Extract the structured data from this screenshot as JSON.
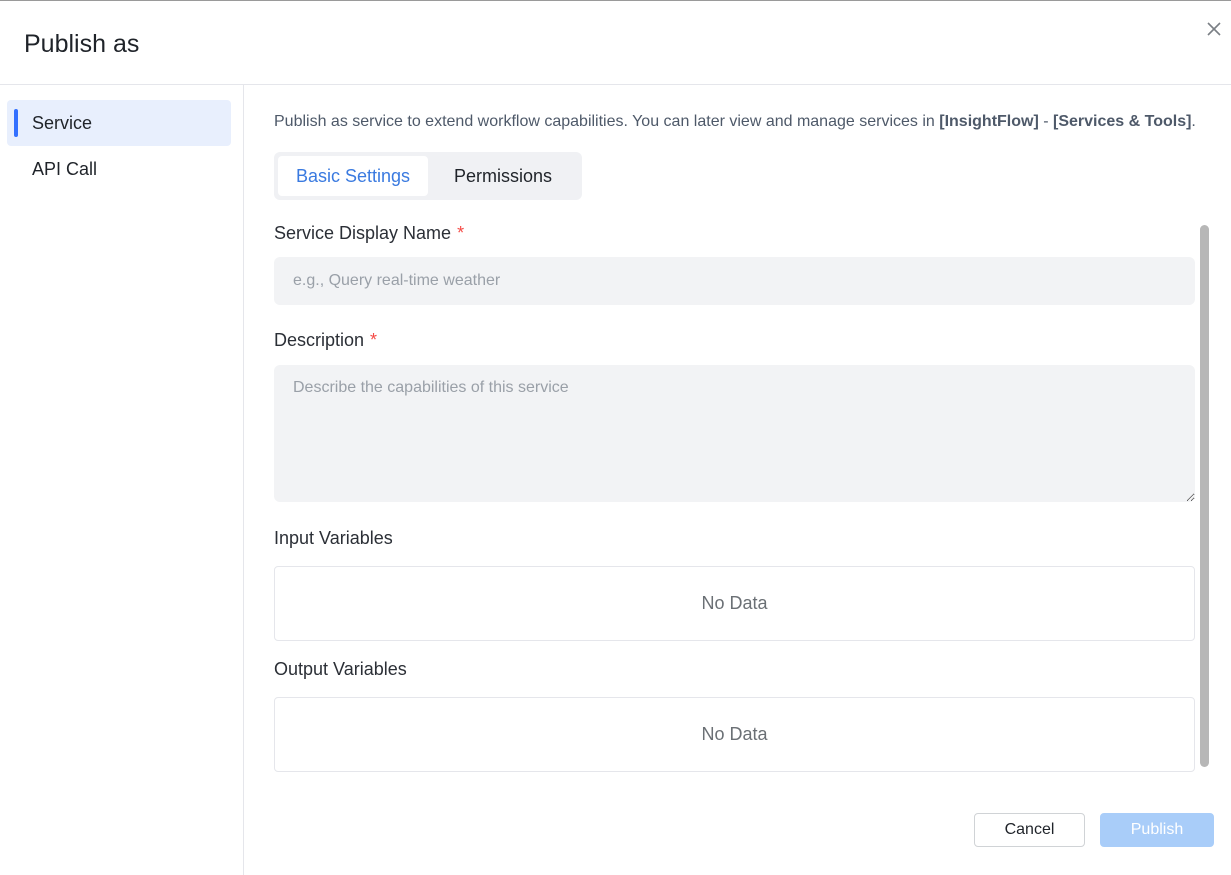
{
  "dialog": {
    "title": "Publish as",
    "close_icon": "close-icon"
  },
  "sidebar": {
    "items": [
      {
        "label": "Service",
        "active": true
      },
      {
        "label": "API Call",
        "active": false
      }
    ]
  },
  "main": {
    "intro": {
      "prefix": "Publish as service to extend workflow capabilities. You can later view and manage services in ",
      "link1": "[InsightFlow]",
      "separator": " - ",
      "link2": "[Services & Tools]",
      "suffix": "."
    },
    "tabs": [
      {
        "label": "Basic Settings",
        "active": true
      },
      {
        "label": "Permissions",
        "active": false
      }
    ],
    "fields": {
      "display_name": {
        "label": "Service Display Name",
        "required_mark": "*",
        "placeholder": "e.g., Query real-time weather",
        "value": ""
      },
      "description": {
        "label": "Description",
        "required_mark": "*",
        "placeholder": "Describe the capabilities of this service",
        "value": ""
      },
      "input_variables": {
        "label": "Input Variables",
        "empty_text": "No Data"
      },
      "output_variables": {
        "label": "Output Variables",
        "empty_text": "No Data"
      }
    }
  },
  "footer": {
    "cancel_label": "Cancel",
    "publish_label": "Publish"
  },
  "colors": {
    "accent": "#3370ff",
    "active_nav_bg": "#e8effd",
    "publish_disabled": "#a9cdf9",
    "required": "#f54a45"
  }
}
